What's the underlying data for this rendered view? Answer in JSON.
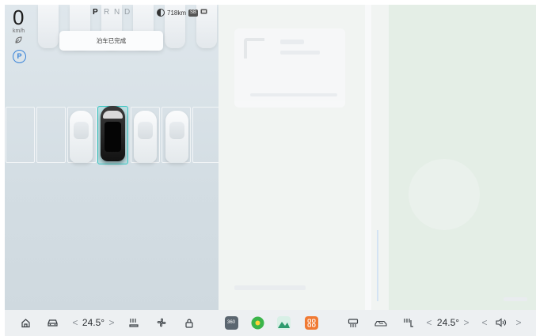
{
  "status": {
    "speed": "0",
    "speed_unit": "km/h",
    "gears": [
      "P",
      "R",
      "N",
      "D"
    ],
    "active_gear": "P",
    "range": "718km",
    "range_tag": "SB"
  },
  "toast": {
    "message": "泊车已完成"
  },
  "dock": {
    "left_temp": "24.5°",
    "right_temp": "24.5°",
    "chevron_left": "<",
    "chevron_right": ">"
  },
  "apps": [
    {
      "name": "360-camera-app-icon",
      "label": "360",
      "color": "#5b6670"
    },
    {
      "name": "music-app-icon",
      "color": "#3bb54a"
    },
    {
      "name": "gallery-app-icon",
      "color": "#2c9b6d"
    },
    {
      "name": "apps-grid-app-icon",
      "color": "#f07a33"
    }
  ],
  "colors": {
    "accent_parking": "#38c7c2",
    "parking_badge": "#3a84d8"
  }
}
